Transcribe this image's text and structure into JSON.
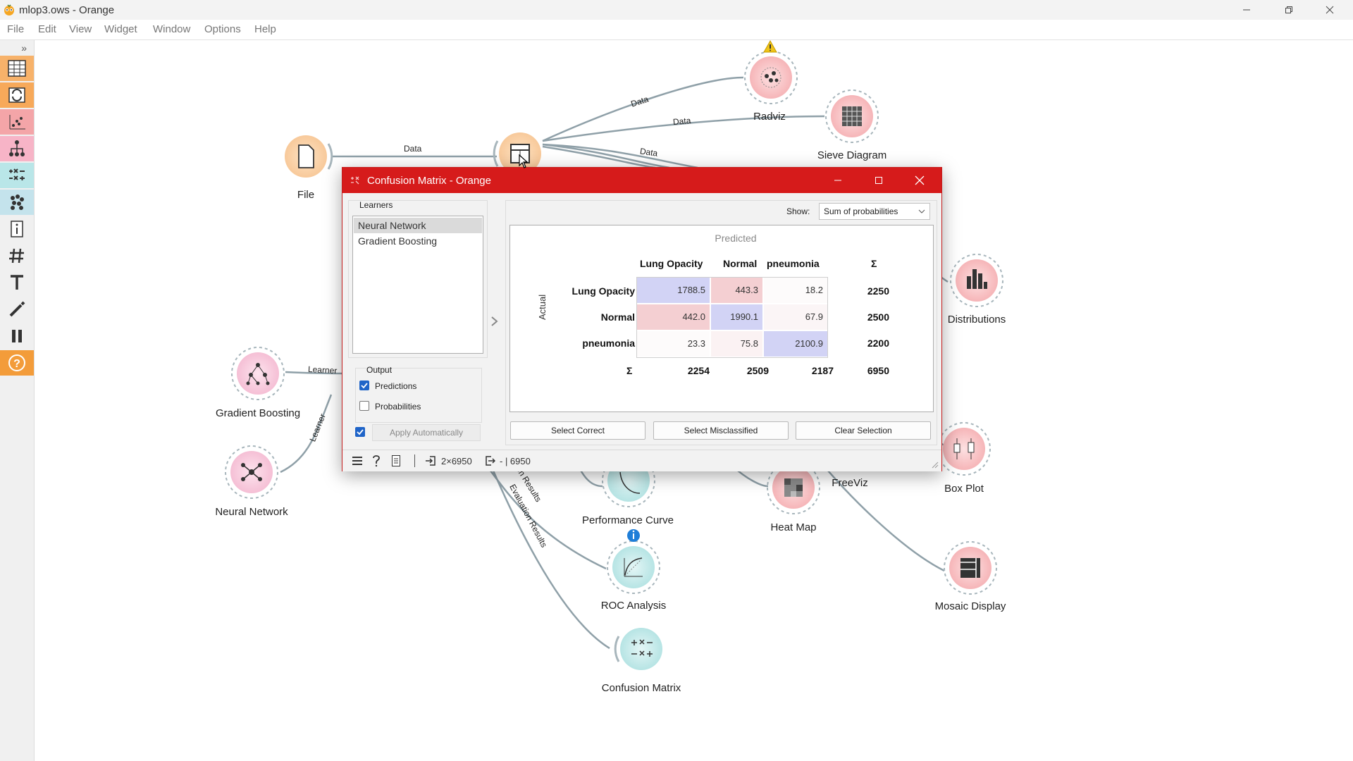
{
  "window": {
    "title": "mlop3.ows - Orange"
  },
  "menu": [
    "File",
    "Edit",
    "View",
    "Widget",
    "Window",
    "Options",
    "Help"
  ],
  "toolbox": {
    "collapse_glyph": "»",
    "help_glyph": "?"
  },
  "nodes": {
    "file": "File",
    "radviz": "Radviz",
    "sieve": "Sieve Diagram",
    "distributions": "Distributions",
    "gradient_boosting": "Gradient Boosting",
    "neural_network": "Neural Network",
    "performance_curve": "Performance Curve",
    "heat_map": "Heat Map",
    "freeviz": "FreeViz",
    "box_plot": "Box Plot",
    "roc_analysis": "ROC Analysis",
    "mosaic": "Mosaic Display",
    "confusion_matrix": "Confusion Matrix"
  },
  "links": {
    "data1": "Data",
    "data2": "Data",
    "data3": "Data",
    "data4": "Data",
    "learner1": "Learner",
    "learner2": "Learner",
    "eval1": "on Results",
    "eval2": "Evaluation Results"
  },
  "dialog": {
    "title": "Confusion Matrix - Orange",
    "learners_label": "Learners",
    "learners": [
      "Neural Network",
      "Gradient Boosting"
    ],
    "output_label": "Output",
    "predictions_label": "Predictions",
    "probabilities_label": "Probabilities",
    "apply_label": "Apply Automatically",
    "show_label": "Show:",
    "show_value": "Sum of probabilities",
    "predicted_label": "Predicted",
    "actual_label": "Actual",
    "columns": [
      "Lung Opacity",
      "Normal",
      "pneumonia"
    ],
    "sigma": "Σ",
    "rows": [
      {
        "label": "Lung Opacity",
        "cells": [
          "1788.5",
          "443.3",
          "18.2"
        ],
        "sum": "2250"
      },
      {
        "label": "Normal",
        "cells": [
          "442.0",
          "1990.1",
          "67.9"
        ],
        "sum": "2500"
      },
      {
        "label": "pneumonia",
        "cells": [
          "23.3",
          "75.8",
          "2100.9"
        ],
        "sum": "2200"
      }
    ],
    "col_sums": [
      "2254",
      "2509",
      "2187"
    ],
    "total": "6950",
    "btn_correct": "Select Correct",
    "btn_misclassified": "Select Misclassified",
    "btn_clear": "Clear Selection",
    "status_in": "2×6950",
    "status_out": "- | 6950"
  },
  "colors": {
    "accent": "#d61b1b",
    "diag": "#d2d3f5",
    "offdiag": "#f4cfd2",
    "light": "#fbf2f3"
  }
}
